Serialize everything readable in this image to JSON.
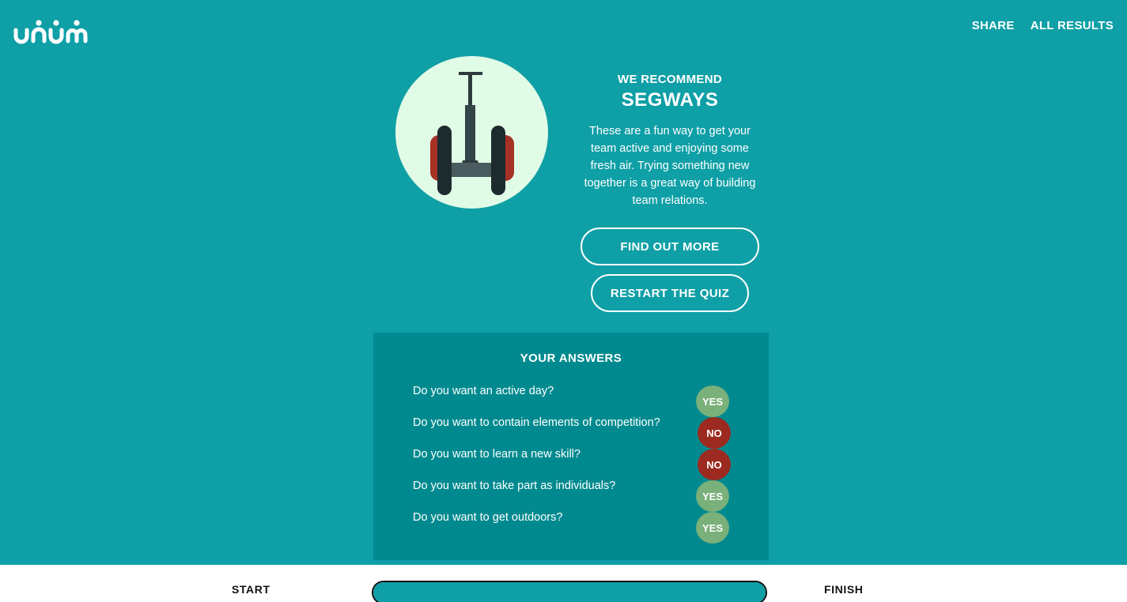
{
  "header": {
    "logo_text": "unum",
    "nav": [
      {
        "label": "SHARE"
      },
      {
        "label": "ALL RESULTS"
      }
    ]
  },
  "recommendation": {
    "kicker": "WE RECOMMEND",
    "title": "SEGWAYS",
    "description": "These are a fun way to get your team active and enjoying some fresh air. Trying something new together is a great way of building team relations.",
    "illustration_icon": "segway-icon",
    "find_out_more": "FIND OUT MORE",
    "restart": "RESTART THE QUIZ"
  },
  "answers": {
    "heading": "YOUR ANSWERS",
    "items": [
      {
        "question": "Do you want an active day?",
        "answer": "YES"
      },
      {
        "question": "Do you want to contain elements of competition?",
        "answer": "NO"
      },
      {
        "question": "Do you want to learn a new skill?",
        "answer": "NO"
      },
      {
        "question": "Do you want to take part as individuals?",
        "answer": "YES"
      },
      {
        "question": "Do you want to get outdoors?",
        "answer": "YES"
      }
    ]
  },
  "footer": {
    "start_label": "START",
    "finish_label": "FINISH",
    "progress_percent": 100
  },
  "colors": {
    "background": "#0f9fa6",
    "panel": "#008a8f",
    "yes": "#7ab07a",
    "no": "#9c2a20",
    "illustration_bg": "#e0fbe6"
  }
}
